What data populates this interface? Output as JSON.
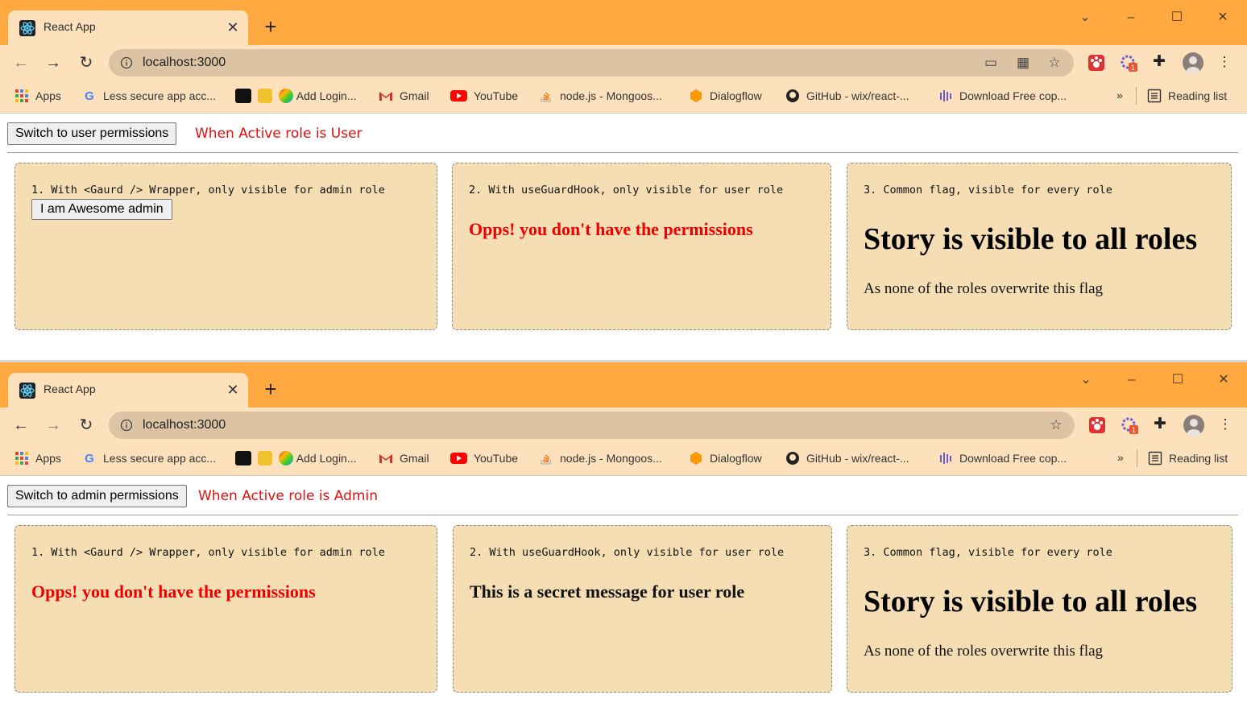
{
  "windows": [
    {
      "tab_title": "React App",
      "url": "localhost:3000",
      "switch_label": "Switch to user permissions",
      "role_label": "When Active role is User",
      "cards": {
        "admin_heading": "1. With <Gaurd /> Wrapper, only visible for admin role",
        "admin_button": "I am Awesome admin",
        "user_heading": "2. With useGuardHook, only visible for user role",
        "user_message": "Opps! you don't have the permissions",
        "common_heading": "3. Common flag, visible for every role",
        "common_title": "Story is visible to all roles",
        "common_sub": "As none of the roles overwrite this flag"
      }
    },
    {
      "tab_title": "React App",
      "url": "localhost:3000",
      "switch_label": "Switch to admin permissions",
      "role_label": "When Active role is Admin",
      "cards": {
        "admin_heading": "1. With <Gaurd /> Wrapper, only visible for admin role",
        "admin_message": "Opps! you don't have the permissions",
        "user_heading": "2. With useGuardHook, only visible for user role",
        "user_message": "This is a secret message for user role",
        "common_heading": "3. Common flag, visible for every role",
        "common_title": "Story is visible to all roles",
        "common_sub": "As none of the roles overwrite this flag"
      }
    }
  ],
  "bookmarks": {
    "apps": "Apps",
    "less_secure": "Less secure app acc...",
    "add_login": "Add Login...",
    "gmail": "Gmail",
    "youtube": "YouTube",
    "nodejs": "node.js - Mongoos...",
    "dialogflow": "Dialogflow",
    "github": "GitHub - wix/react-...",
    "download": "Download Free cop...",
    "more": "»",
    "reading_list": "Reading list"
  },
  "extension_badge": "1",
  "colors": {
    "tabstrip": "#ffa940",
    "toolbar": "#fde1bd",
    "omnibox": "#dcc3a3",
    "card_bg": "#f5deb3",
    "alert_red": "#ee0000"
  }
}
